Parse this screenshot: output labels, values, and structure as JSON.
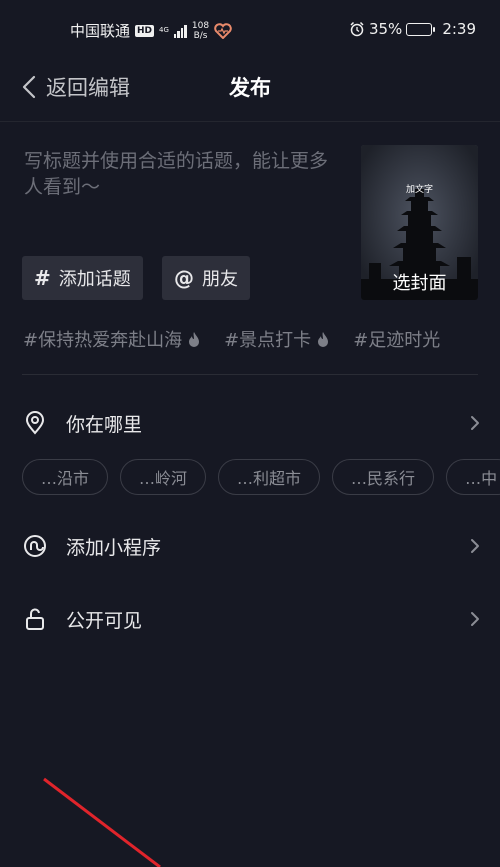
{
  "status_bar": {
    "carrier": "中国联通",
    "hd": "HD",
    "network": "4G",
    "speed_value": "108",
    "speed_unit": "B/s",
    "battery": "35%",
    "battery_level": 0.35,
    "time": "2:39"
  },
  "nav": {
    "back_label": "返回编辑",
    "title": "发布"
  },
  "caption": {
    "placeholder": "写标题并使用合适的话题，能让更多人看到～"
  },
  "cover": {
    "add_text": "加文字",
    "select_label": "选封面"
  },
  "buttons": {
    "topic": {
      "symbol": "#",
      "label": "添加话题"
    },
    "friends": {
      "symbol": "@",
      "label": "朋友"
    }
  },
  "hashtags": [
    "#保持热爱奔赴山海",
    "#景点打卡",
    "#足迹时光"
  ],
  "location": {
    "label": "你在哪里",
    "chips": [
      "…沿市",
      "…岭河",
      "…利超市",
      "…民系行",
      "…中"
    ]
  },
  "mini_program": {
    "label": "添加小程序"
  },
  "visibility": {
    "label": "公开可见"
  },
  "colors": {
    "background": "#161823",
    "chip_bg": "#2d2f3a",
    "annotation_arrow": "#e0242b"
  }
}
